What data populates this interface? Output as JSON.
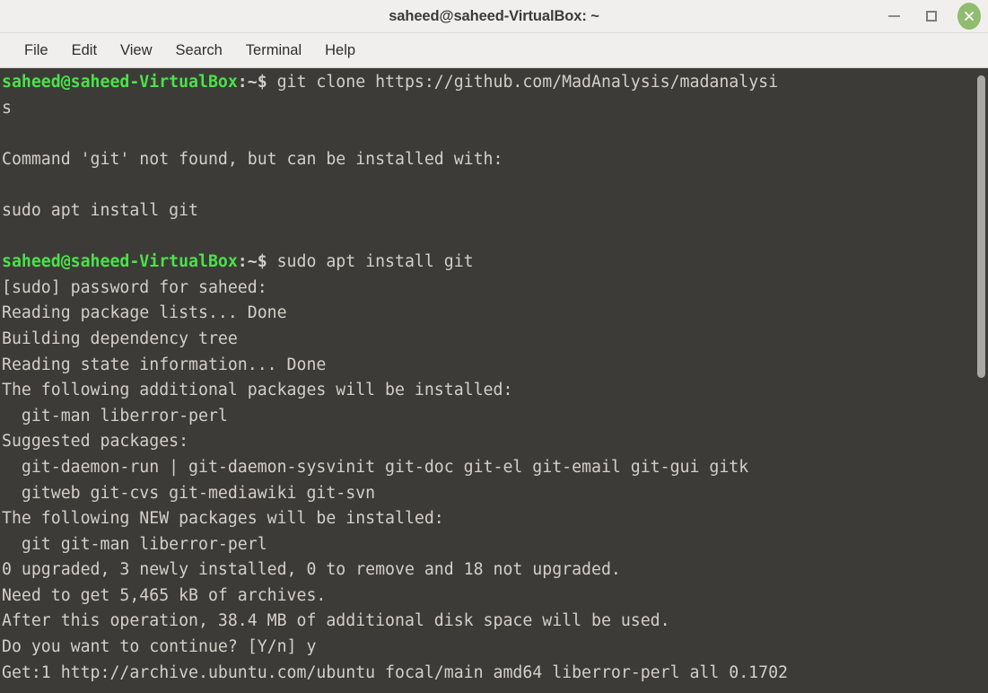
{
  "window": {
    "title": "saheed@saheed-VirtualBox: ~",
    "controls": {
      "minimize": "minimize-button",
      "maximize": "maximize-button",
      "close": "close-button"
    }
  },
  "menubar": {
    "items": [
      {
        "label": "File"
      },
      {
        "label": "Edit"
      },
      {
        "label": "View"
      },
      {
        "label": "Search"
      },
      {
        "label": "Terminal"
      },
      {
        "label": "Help"
      }
    ]
  },
  "terminal": {
    "prompt_user_host": "saheed@saheed-VirtualBox",
    "prompt_path": ":~$",
    "lines": [
      {
        "type": "prompt",
        "prompt": "saheed@saheed-VirtualBox",
        "path": ":~$",
        "command": " git clone https://github.com/MadAnalysis/madanalysi"
      },
      {
        "type": "output",
        "text": "s"
      },
      {
        "type": "output",
        "text": ""
      },
      {
        "type": "output",
        "text": "Command 'git' not found, but can be installed with:"
      },
      {
        "type": "output",
        "text": ""
      },
      {
        "type": "output",
        "text": "sudo apt install git"
      },
      {
        "type": "output",
        "text": ""
      },
      {
        "type": "prompt",
        "prompt": "saheed@saheed-VirtualBox",
        "path": ":~$",
        "command": " sudo apt install git"
      },
      {
        "type": "output",
        "text": "[sudo] password for saheed:"
      },
      {
        "type": "output",
        "text": "Reading package lists... Done"
      },
      {
        "type": "output",
        "text": "Building dependency tree"
      },
      {
        "type": "output",
        "text": "Reading state information... Done"
      },
      {
        "type": "output",
        "text": "The following additional packages will be installed:"
      },
      {
        "type": "output",
        "text": "  git-man liberror-perl"
      },
      {
        "type": "output",
        "text": "Suggested packages:"
      },
      {
        "type": "output",
        "text": "  git-daemon-run | git-daemon-sysvinit git-doc git-el git-email git-gui gitk"
      },
      {
        "type": "output",
        "text": "  gitweb git-cvs git-mediawiki git-svn"
      },
      {
        "type": "output",
        "text": "The following NEW packages will be installed:"
      },
      {
        "type": "output",
        "text": "  git git-man liberror-perl"
      },
      {
        "type": "output",
        "text": "0 upgraded, 3 newly installed, 0 to remove and 18 not upgraded."
      },
      {
        "type": "output",
        "text": "Need to get 5,465 kB of archives."
      },
      {
        "type": "output",
        "text": "After this operation, 38.4 MB of additional disk space will be used."
      },
      {
        "type": "output",
        "text": "Do you want to continue? [Y/n] y"
      },
      {
        "type": "output",
        "text": "Get:1 http://archive.ubuntu.com/ubuntu focal/main amd64 liberror-perl all 0.1702"
      }
    ]
  },
  "colors": {
    "terminal_background": "#3c3b37",
    "terminal_foreground": "#d4cfc8",
    "prompt_green": "#4ae24a",
    "titlebar_background": "#f0efee",
    "close_button_green": "#8fbc6e",
    "scrollbar_thumb": "#a8a8a4"
  }
}
